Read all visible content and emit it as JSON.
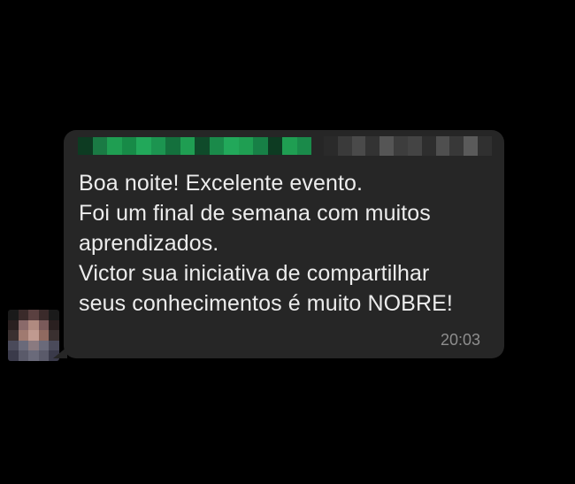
{
  "chat": {
    "message": {
      "lines": [
        "Boa noite! Excelente evento.",
        "Foi um final de semana com muitos",
        "aprendizados.",
        "Victor sua iniciativa de compartilhar",
        "seus conhecimentos é muito NOBRE!"
      ],
      "time": "20:03"
    },
    "sender": {
      "name_redacted": true,
      "phone_redacted": true
    },
    "colors": {
      "background": "#000000",
      "bubble": "#262626",
      "text": "#ececec",
      "timestamp": "#8e8e8e",
      "sender_name": "#1f9e52"
    },
    "avatar_icon": "pixelated-avatar-icon"
  }
}
